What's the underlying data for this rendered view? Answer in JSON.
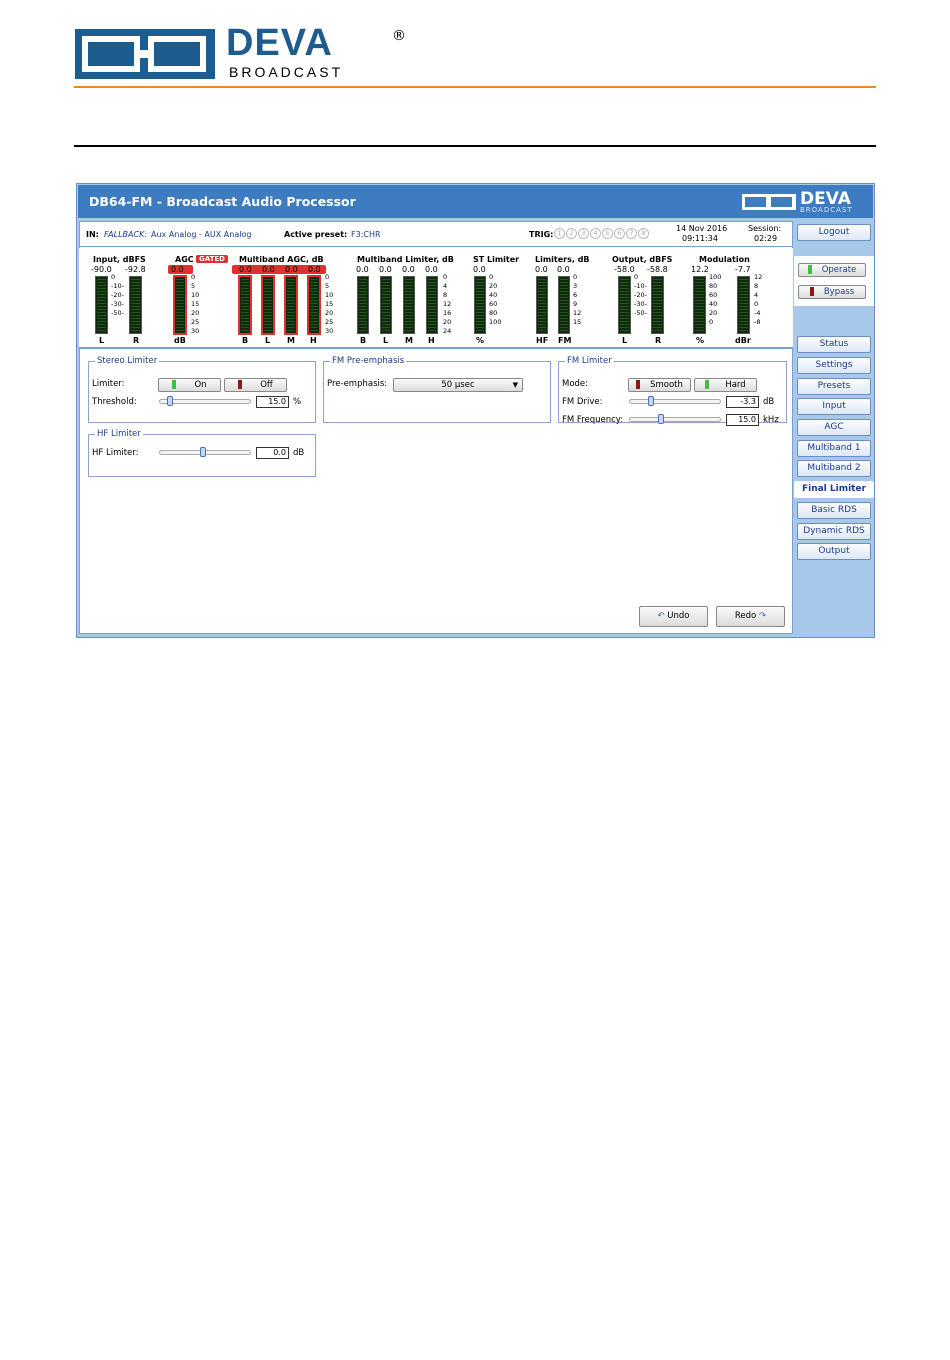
{
  "brand": {
    "name": "DEVA",
    "sub": "BROADCAST",
    "reg": "®"
  },
  "app": {
    "title": "DB64-FM - Broadcast Audio Processor",
    "logo_name": "DEVA",
    "logo_sub": "BROADCAST"
  },
  "status": {
    "in_label": "IN:",
    "fallback": "FALLBACK:",
    "input_desc": "Aux Analog - AUX Analog",
    "preset_label": "Active preset:",
    "preset_value": "F3:CHR",
    "trig_label": "TRIG:",
    "trig": [
      "1",
      "2",
      "3",
      "4",
      "5",
      "6",
      "7",
      "8"
    ],
    "date": "14 Nov 2016",
    "time": "09:11:34",
    "session_label": "Session:",
    "session_value": "02:29"
  },
  "meters": {
    "input": {
      "title": "Input, dBFS",
      "vals": [
        "-90.0",
        "-92.8"
      ],
      "scale": [
        "0",
        "-10-",
        "-20-",
        "-30-",
        "-50-"
      ],
      "chans": [
        "L",
        "R"
      ]
    },
    "agc": {
      "title": "AGC",
      "badge": "GATED",
      "val": "0.0",
      "scale": [
        "0",
        "5",
        "10",
        "15",
        "20",
        "25",
        "30"
      ],
      "unit": "dB"
    },
    "mbagc": {
      "title": "Multiband AGC, dB",
      "vals": [
        "0.0",
        "0.0",
        "0.0",
        "0.0"
      ],
      "scale": [
        "0",
        "5",
        "10",
        "15",
        "20",
        "25",
        "30"
      ],
      "chans": [
        "B",
        "L",
        "M",
        "H"
      ]
    },
    "mblim": {
      "title": "Multiband Limiter, dB",
      "vals": [
        "0.0",
        "0.0",
        "0.0",
        "0.0"
      ],
      "scale": [
        "0",
        "4",
        "8",
        "12",
        "16",
        "20",
        "24"
      ],
      "chans": [
        "B",
        "L",
        "M",
        "H"
      ]
    },
    "stlim": {
      "title": "ST Limiter",
      "val": "0.0",
      "scale": [
        "0",
        "20",
        "40",
        "60",
        "80",
        "100"
      ],
      "unit": "%"
    },
    "limiters": {
      "title": "Limiters, dB",
      "vals": [
        "0.0",
        "0.0"
      ],
      "scale": [
        "0",
        "3",
        "6",
        "9",
        "12",
        "15"
      ],
      "chans": [
        "HF",
        "FM"
      ]
    },
    "output": {
      "title": "Output, dBFS",
      "vals": [
        "-58.0",
        "-58.8"
      ],
      "scale": [
        "0",
        "-10-",
        "-20-",
        "-30-",
        "-50-"
      ],
      "chans": [
        "L",
        "R"
      ]
    },
    "modulation": {
      "title": "Modulation",
      "vals": [
        "12.2",
        "-7.7"
      ],
      "scale1": [
        "100",
        "80",
        "60",
        "40",
        "20",
        "0"
      ],
      "scale2": [
        "12",
        "8",
        "4",
        "0",
        "-4",
        "-8"
      ],
      "chans": [
        "%",
        "dBr"
      ]
    }
  },
  "stereo_limiter": {
    "legend": "Stereo Limiter",
    "limiter_label": "Limiter:",
    "on": "On",
    "off": "Off",
    "threshold_label": "Threshold:",
    "threshold": "15.0",
    "threshold_unit": "%",
    "threshold_level": 0.08
  },
  "hf_limiter": {
    "legend": "HF Limiter",
    "label": "HF Limiter:",
    "value": "0.0",
    "unit": "dB",
    "level": 0.48
  },
  "fm_preemphasis": {
    "legend": "FM Pre-emphasis",
    "label": "Pre-emphasis:",
    "value": "50 µsec"
  },
  "fm_limiter": {
    "legend": "FM Limiter",
    "mode_label": "Mode:",
    "smooth": "Smooth",
    "hard": "Hard",
    "drive_label": "FM Drive:",
    "drive": "-3.3",
    "drive_unit": "dB",
    "drive_level": 0.22,
    "freq_label": "FM Frequency:",
    "freq": "15.0",
    "freq_unit": "kHz",
    "freq_level": 0.33
  },
  "actions": {
    "undo": "Undo",
    "redo": "Redo"
  },
  "sidebar": {
    "logout": "Logout",
    "operate": "Operate",
    "bypass": "Bypass",
    "nav": [
      "Status",
      "Settings",
      "Presets",
      "Input",
      "AGC",
      "Multiband 1",
      "Multiband 2",
      "Final Limiter",
      "Basic RDS",
      "Dynamic RDS",
      "Output"
    ],
    "active": "Final Limiter"
  },
  "colors": {
    "accent": "#3d7cc0",
    "orange": "#e8892c",
    "meter_bg": "#0f2a0c",
    "meter_green": "#2f8a2a",
    "alarm_red": "#e03030"
  }
}
